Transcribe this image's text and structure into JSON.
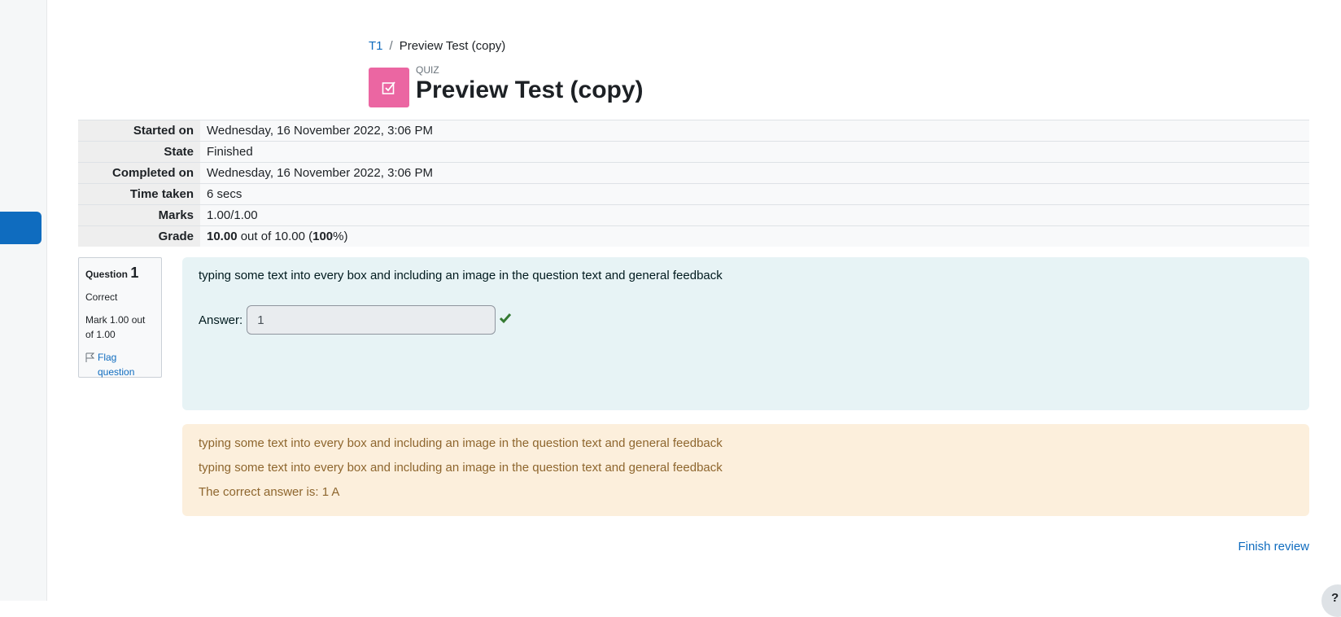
{
  "breadcrumb": {
    "course": "T1",
    "separator": "/",
    "current": "Preview Test (copy)"
  },
  "header": {
    "activity_type": "QUIZ",
    "title": "Preview Test (copy)",
    "icon": "quiz-check-icon",
    "icon_color": "#eb66a2"
  },
  "summary": {
    "rows": [
      {
        "label": "Started on",
        "value": "Wednesday, 16 November 2022, 3:06 PM"
      },
      {
        "label": "State",
        "value": "Finished"
      },
      {
        "label": "Completed on",
        "value": "Wednesday, 16 November 2022, 3:06 PM"
      },
      {
        "label": "Time taken",
        "value": "6 secs"
      },
      {
        "label": "Marks",
        "value": "1.00/1.00"
      }
    ],
    "grade": {
      "label": "Grade",
      "score": "10.00",
      "out_of_text": " out of 10.00 (",
      "percent": "100",
      "suffix": "%)"
    }
  },
  "question": {
    "label": "Question",
    "number": "1",
    "state": "Correct",
    "mark": "Mark 1.00 out of 1.00",
    "flag_label": "Flag question",
    "text": "typing some text into every box and including an image in the question text and general feedback",
    "answer_label": "Answer:",
    "answer_value": "1",
    "correct_icon": "check-icon",
    "correct_color": "#357a32"
  },
  "outcome": {
    "feedback_1": "typing some text into every box and including an image in the question text and general feedback",
    "feedback_2": "typing some text into every box and including an image in the question text and general feedback",
    "right_answer": "The correct answer is: 1 A"
  },
  "footer": {
    "finish_review": "Finish review",
    "help_glyph": "?"
  },
  "colors": {
    "accent": "#0f6cbf"
  }
}
